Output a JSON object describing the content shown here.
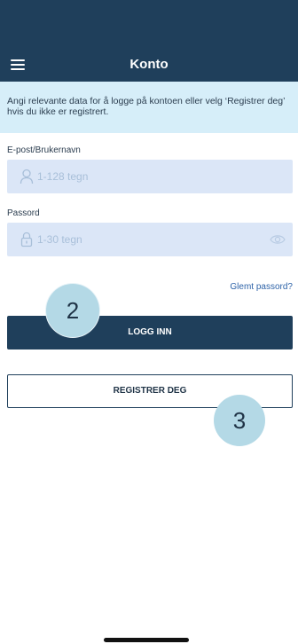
{
  "header": {
    "title": "Konto",
    "menu_icon": "hamburger-menu-icon",
    "background": "#1f3f5b"
  },
  "info": {
    "text": "Angi relevante data for å logge på kontoen eller velg ‘Registrer deg’ hvis du ikke er registrert.",
    "background": "#d6eef9"
  },
  "username": {
    "label": "E-post/Brukernavn",
    "placeholder": "1-128 tegn",
    "icon": "user-icon"
  },
  "password": {
    "label": "Passord",
    "placeholder": "1-30 tegn",
    "icon": "lock-icon",
    "toggle_icon": "eye-icon"
  },
  "forgot_link": "Glemt passord?",
  "buttons": {
    "login": "LOGG INN",
    "register": "REGISTRER DEG"
  },
  "steps": {
    "first": "2",
    "second": "3"
  }
}
